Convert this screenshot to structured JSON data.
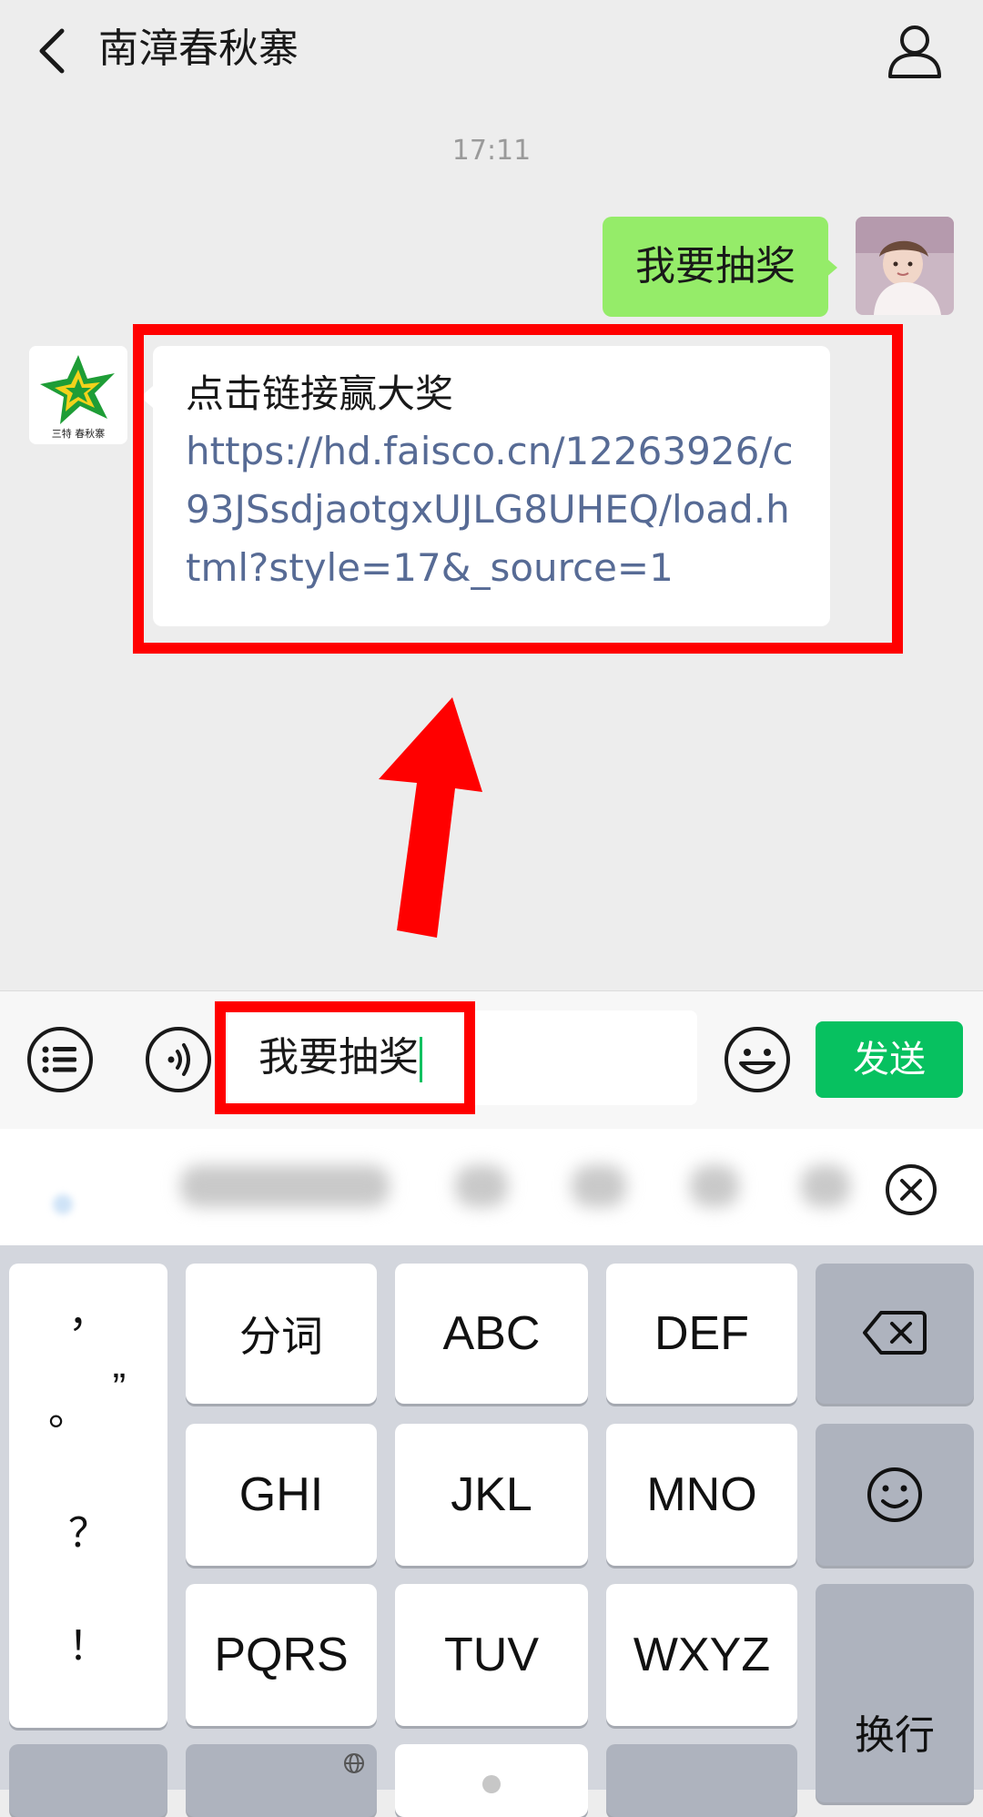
{
  "header": {
    "title": "南漳春秋寨",
    "back_icon": "chevron-left-icon",
    "profile_icon": "user-icon"
  },
  "chat": {
    "timestamp": "17:11",
    "sent_message": "我要抽奖",
    "received_message": {
      "text": "点击链接赢大奖",
      "link": "https://hd.faisco.cn/12263926/c93JSsdjaotgxUJLG8UHEQ/load.html?style=17&_source=1"
    },
    "contact_logo_text": "三特 春秋寨"
  },
  "input_bar": {
    "input_value": "我要抽奖",
    "send_label": "发送"
  },
  "keyboard": {
    "punct_keys": [
      "，",
      "。",
      "”",
      "？",
      "！"
    ],
    "rows": [
      [
        "分词",
        "ABC",
        "DEF"
      ],
      [
        "GHI",
        "JKL",
        "MNO"
      ],
      [
        "PQRS",
        "TUV",
        "WXYZ"
      ]
    ],
    "enter_label": "换行"
  },
  "colors": {
    "accent_green": "#07c160",
    "sent_bubble": "#95ec69",
    "link": "#576b95",
    "highlight_red": "#ff0000"
  }
}
